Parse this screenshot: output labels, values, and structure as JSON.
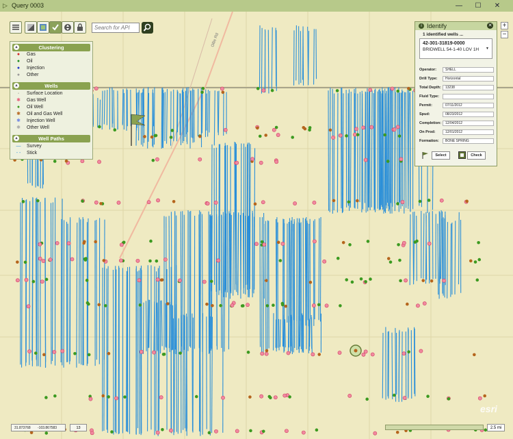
{
  "window": {
    "title": "Query 0003",
    "minimize": "—",
    "maximize": "☐",
    "close": "✕"
  },
  "toolbar": {
    "tools": [
      "list-icon",
      "layers-icon",
      "basemap-icon",
      "check-icon",
      "pan-icon",
      "lock-icon"
    ],
    "search_placeholder": "Search for API",
    "search_button": "magnifier-icon"
  },
  "legend": {
    "clustering": {
      "title": "Clustering",
      "items": [
        {
          "label": "Gas",
          "color": "#d22727"
        },
        {
          "label": "Oil",
          "color": "#1e8a1e"
        },
        {
          "label": "Injection",
          "color": "#2338c8"
        },
        {
          "label": "Other",
          "color": "#9a9a9a"
        }
      ]
    },
    "wells": {
      "title": "Wells",
      "items": [
        {
          "label": "Surface Location",
          "symbol": "dot",
          "color": "#222222"
        },
        {
          "label": "Gas Well",
          "symbol": "star",
          "color": "#e85a78"
        },
        {
          "label": "Oil Well",
          "symbol": "circle",
          "color": "#3c9a20"
        },
        {
          "label": "Oil and Gas Well",
          "symbol": "star",
          "color": "#b5651d"
        },
        {
          "label": "Injection Well",
          "symbol": "star",
          "color": "#6f86e3"
        },
        {
          "label": "Other Well",
          "symbol": "star",
          "color": "#a9a9a9"
        }
      ]
    },
    "paths": {
      "title": "Well Paths",
      "items": [
        {
          "label": "Survey",
          "style": "solid",
          "color": "#2a8fd9"
        },
        {
          "label": "Stick",
          "style": "dashed",
          "color": "#2a8fd9"
        }
      ]
    }
  },
  "map": {
    "road_label": "Ollie Rd",
    "accent": "#2a8fd9"
  },
  "identify": {
    "title": "Identify",
    "count_text": "1 identified wells ...",
    "api": "42-301-31819-0000",
    "well_name": "BRIDWELL 54-1-40 LOV 1H",
    "fields": [
      {
        "label": "Operator:",
        "value": "SHELL"
      },
      {
        "label": "Drill Type:",
        "value": "Horizontal"
      },
      {
        "label": "Total Depth:",
        "value": "13238"
      },
      {
        "label": "Fluid Type:",
        "value": ""
      },
      {
        "label": "Permit:",
        "value": "07/11/2012"
      },
      {
        "label": "Spud:",
        "value": "08/23/2012"
      },
      {
        "label": "Completion:",
        "value": "12/04/2012"
      },
      {
        "label": "On Prod:",
        "value": "12/01/2012"
      },
      {
        "label": "Formation:",
        "value": "BONE SPRING"
      }
    ],
    "select_label": "Select",
    "check_label": "Check"
  },
  "zoom": {
    "in": "+",
    "out": "−"
  },
  "status": {
    "lat": "31.873768",
    "lon": "-103.867583",
    "zoom_level": "13",
    "scale": "2.5 mi"
  },
  "attribution": "esri"
}
